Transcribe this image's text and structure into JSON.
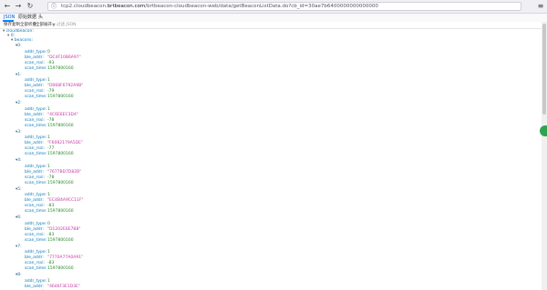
{
  "browser": {
    "back_icon": "←",
    "forward_icon": "→",
    "reload_icon": "↻",
    "url_prefix": "tcp2.cloudbeacon.",
    "url_domain": "brtbeacon.com",
    "url_rest": "/brtbeacon-cloudbeacon-web/data/getBeaconListData.do?cb_id=30ae7b6400000000000000",
    "menu_icon": "≡"
  },
  "tabs": {
    "json": "JSON",
    "raw": "原始数据",
    "headers": "头"
  },
  "toolbar": {
    "save": "保存",
    "copy": "复制",
    "collapse": "全部折叠",
    "expand": "全部展开",
    "filter": "过滤 JSON"
  },
  "root_key": "cloudbeacon:",
  "level1_key": "0:",
  "beacons_key": "beacons:",
  "beacons": [
    {
      "idx": "0:",
      "addr_type": "0",
      "ble_addr": "\"DC4F10B6A97\"",
      "rssi": "-93",
      "scan_time": "1597800160"
    },
    {
      "idx": "1:",
      "addr_type": "1",
      "ble_addr": "\"D068F6792A9B\"",
      "rssi": "-79",
      "scan_time": "1597800160"
    },
    {
      "idx": "2:",
      "addr_type": "1",
      "ble_addr": "\"4C6E6EC3D4\"",
      "rssi": "-78",
      "scan_time": "1597800160"
    },
    {
      "idx": "3:",
      "addr_type": "1",
      "ble_addr": "\"F6082179A5DE\"",
      "rssi": "-77",
      "scan_time": "1597800160"
    },
    {
      "idx": "4:",
      "addr_type": "1",
      "ble_addr": "\"7677BD7D82B\"",
      "rssi": "-78",
      "scan_time": "1597800160"
    },
    {
      "idx": "5:",
      "addr_type": "1",
      "ble_addr": "\"EC4B4A9CC11F\"",
      "rssi": "-83",
      "scan_time": "1597800160"
    },
    {
      "idx": "6:",
      "addr_type": "0",
      "ble_addr": "\"D1202E6E7B8\"",
      "rssi": "-83",
      "scan_time": "1597800160"
    },
    {
      "idx": "7:",
      "addr_type": "1",
      "ble_addr": "\"7770A77A0A91\"",
      "rssi": "-83",
      "scan_time": "1597800160"
    },
    {
      "idx": "8:",
      "addr_type": "1",
      "ble_addr": "\"4646F3E1D3E\"",
      "rssi": "",
      "scan_time": ""
    }
  ],
  "field_labels": {
    "addr_type": "addr_type:",
    "ble_addr": "ble_addr:",
    "rssi": "scan_rssi:",
    "scan_time": "scan_time:"
  }
}
